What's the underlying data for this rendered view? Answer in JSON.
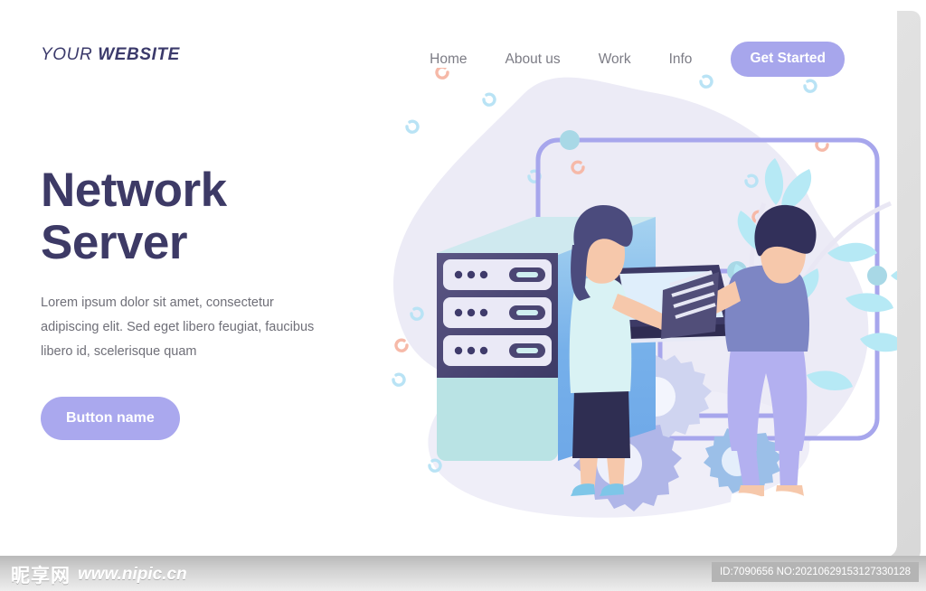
{
  "brand": {
    "word1": "YOUR",
    "word2": "WEBSITE"
  },
  "nav": {
    "links": [
      {
        "label": "Home"
      },
      {
        "label": "About us"
      },
      {
        "label": "Work"
      },
      {
        "label": "Info"
      }
    ],
    "cta_label": "Get Started",
    "cta_color": "#a7a6ec"
  },
  "hero": {
    "title_line1": "Network",
    "title_line2": "Server",
    "title_color": "#3d3a66",
    "paragraph": "Lorem ipsum dolor sit amet, consectetur adipiscing elit. Sed eget libero feugiat, faucibus libero id, scelerisque quam",
    "button_label": "Button name",
    "button_color": "#aaa8ee"
  },
  "illustration": {
    "name": "network-server-illustration",
    "description": "Server rack with woman at laptop and man carrying equipment, gears and leaves background",
    "colors": {
      "blob": "#eceaf5",
      "server_body": "#b9e3e4",
      "server_side": "#6fa8e8",
      "server_slot_dark": "#4b4673",
      "server_slot_light": "#eae9f6",
      "network_line": "#a7a6ec",
      "leaf": "#b6e9f5",
      "gear": "#b0b6e8",
      "skin": "#f6c8ab",
      "woman_hair": "#4b4b7d",
      "woman_top": "#d9f2f4",
      "woman_skirt": "#2f2e52",
      "man_hair": "#32305a",
      "man_shirt": "#7d86c4",
      "man_pants": "#b3b0f0",
      "laptop": "#3d3a66"
    }
  },
  "footer": {
    "watermark_cn": "昵享网",
    "watermark_url": "www.nipic.cn",
    "id_text": "ID:7090656 NO:20210629153127330128"
  }
}
